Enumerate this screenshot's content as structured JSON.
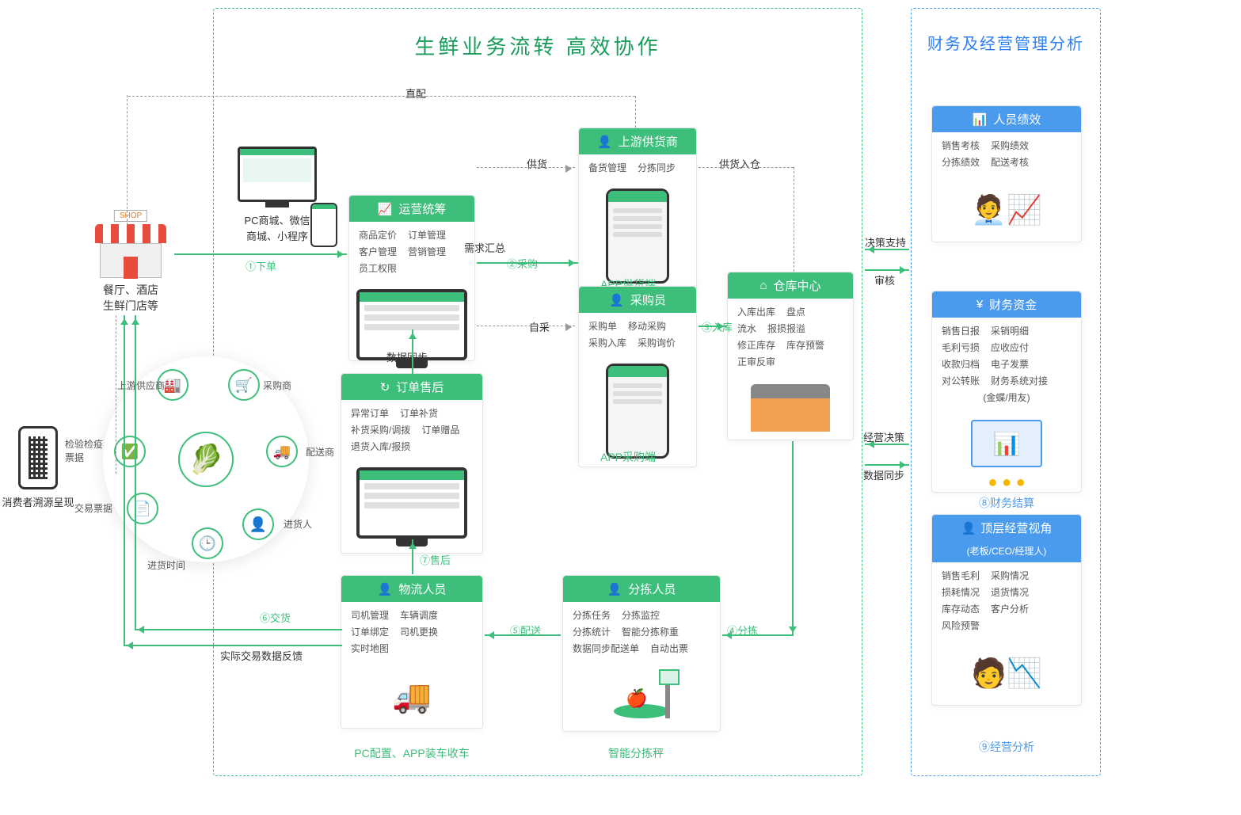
{
  "main_title": "生鲜业务流转  高效协作",
  "right_title": "财务及经营管理分析",
  "shop": {
    "line1": "餐厅、酒店",
    "line2": "生鲜门店等"
  },
  "qr": {
    "label": "消费者溯源呈现"
  },
  "pc_mall": {
    "line1": "PC商城、微信",
    "line2": "商城、小程序"
  },
  "circle": {
    "nodes": [
      "上游供应商",
      "采购商",
      "配送商",
      "进货人",
      "进货时间",
      "交易票据",
      "检验检疫票据"
    ],
    "n0": "上游供应商",
    "n1": "采购商",
    "n2": "配送商",
    "n3": "进货人",
    "n4": "进货时间",
    "n5": "交易票据",
    "n6": "检验检疫\n票据"
  },
  "flows": {
    "order": "①下单",
    "purchase": "②采购",
    "in_store": "③入库",
    "sort": "④分拣",
    "deliver": "⑤配送",
    "handover": "⑥交货",
    "after": "⑦售后",
    "fin_settle": "⑧财务结算",
    "biz_analysis": "⑨经营分析",
    "direct": "直配",
    "supply": "供货",
    "supply_in": "供货入仓",
    "demand": "需求汇总",
    "self": "自采",
    "sync": "数据同步",
    "feedback": "实际交易数据反馈",
    "decision": "决策支持",
    "audit": "审核",
    "biz_decision": "经营决策",
    "sync2": "数据同步"
  },
  "cards": {
    "ops": {
      "title": "运营统筹",
      "rows": [
        [
          "商品定价",
          "订单管理"
        ],
        [
          "客户管理",
          "营销管理"
        ],
        [
          "员工权限",
          ""
        ]
      ]
    },
    "supplier": {
      "title": "上游供货商",
      "rows": [
        [
          "备货管理",
          "分拣同步"
        ]
      ],
      "caption": "APP供货端"
    },
    "buyer": {
      "title": "采购员",
      "rows": [
        [
          "采购单",
          "移动采购"
        ],
        [
          "采购入库",
          "采购询价"
        ]
      ],
      "caption": "APP采购端"
    },
    "warehouse": {
      "title": "仓库中心",
      "rows": [
        [
          "入库出库",
          "盘点"
        ],
        [
          "流水",
          "报损报溢"
        ],
        [
          "修正库存",
          "库存预警"
        ],
        [
          "正审反审",
          ""
        ]
      ]
    },
    "aftersale": {
      "title": "订单售后",
      "rows": [
        [
          "异常订单",
          "订单补货"
        ],
        [
          "补货采购/调拨",
          "订单赠品"
        ],
        [
          "退货入库/报损",
          ""
        ]
      ]
    },
    "logistics": {
      "title": "物流人员",
      "rows": [
        [
          "司机管理",
          "车辆调度"
        ],
        [
          "订单绑定",
          "司机更换"
        ],
        [
          "实时地图",
          ""
        ]
      ],
      "caption": "PC配置、APP装车收车"
    },
    "sorter": {
      "title": "分拣人员",
      "rows": [
        [
          "分拣任务",
          "分拣监控"
        ],
        [
          "分拣统计",
          "智能分拣称重"
        ],
        [
          "数据同步配送单",
          "自动出票"
        ]
      ],
      "caption": "智能分拣秤"
    },
    "perf": {
      "title": "人员绩效",
      "rows": [
        [
          "销售考核",
          "采购绩效"
        ],
        [
          "分拣绩效",
          "配送考核"
        ]
      ]
    },
    "finance": {
      "title": "财务资金",
      "rows": [
        [
          "销售日报",
          "采销明细"
        ],
        [
          "毛利亏损",
          "应收应付"
        ],
        [
          "收款归档",
          "电子发票"
        ],
        [
          "对公转账",
          "财务系统对接"
        ],
        [
          "",
          "(金蝶/用友)"
        ]
      ]
    },
    "top": {
      "title": "顶层经营视角",
      "subtitle": "(老板/CEO/经理人)",
      "rows": [
        [
          "销售毛利",
          "采购情况"
        ],
        [
          "损耗情况",
          "退货情况"
        ],
        [
          "库存动态",
          "客户分析"
        ],
        [
          "风险预警",
          ""
        ]
      ]
    }
  }
}
